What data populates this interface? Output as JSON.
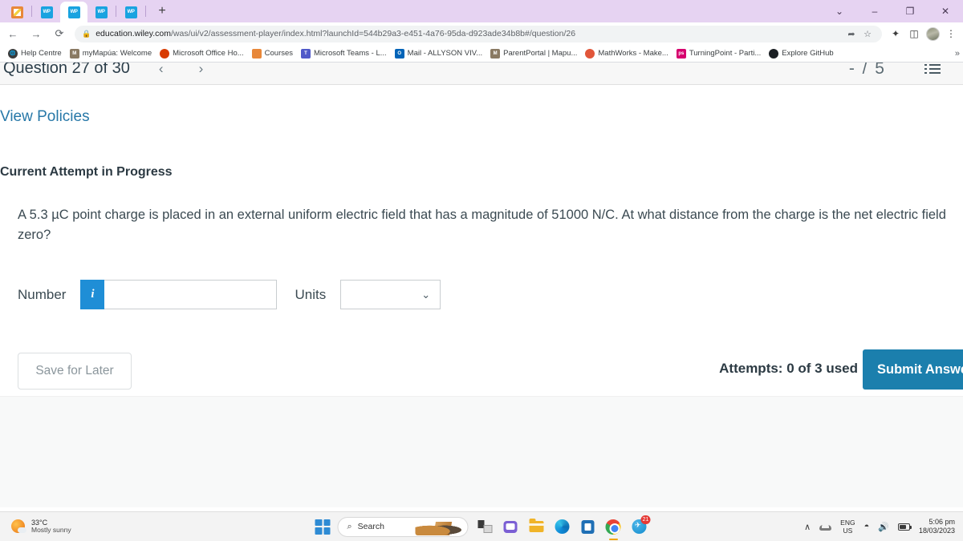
{
  "browser": {
    "tabs": [
      {
        "icon": "canvas-favicon",
        "type": "canvas",
        "active": false
      },
      {
        "icon": "wiley-favicon",
        "type": "wiley",
        "active": false
      },
      {
        "icon": "wiley-favicon",
        "type": "wiley",
        "active": true
      },
      {
        "icon": "wiley-favicon",
        "type": "wiley",
        "active": false
      },
      {
        "icon": "wiley-favicon",
        "type": "wiley",
        "active": false
      }
    ],
    "new_tab_label": "+",
    "window_controls": {
      "tab_search": "⌄",
      "minimize": "–",
      "maximize": "❐",
      "close": "✕"
    },
    "nav": {
      "back": "←",
      "forward": "→",
      "reload": "⟳"
    },
    "omnibox": {
      "lock_icon": "lock-icon",
      "url_domain": "education.wiley.com",
      "url_path": "/was/ui/v2/assessment-player/index.html?launchId=544b29a3-e451-4a76-95da-d923ade34b8b#/question/26",
      "share_icon": "➦",
      "bookmark_star": "☆"
    },
    "toolbar_right": {
      "extensions": "✦",
      "side_panel": "◫",
      "profile": "avatar",
      "menu": "⋮"
    },
    "bookmarks": [
      {
        "label": "Help Centre",
        "icon_text": "",
        "icon_color": "#3b3b3b"
      },
      {
        "label": "myMapúa: Welcome",
        "icon_text": "",
        "icon_color": "#6b5b4a"
      },
      {
        "label": "Microsoft Office Ho...",
        "icon_text": "",
        "icon_color": "#d83b01"
      },
      {
        "label": "Courses",
        "icon_text": "",
        "icon_color": "#e8883a"
      },
      {
        "label": "Microsoft Teams - L...",
        "icon_text": "",
        "icon_color": "#5059c9"
      },
      {
        "label": "Mail - ALLYSON VIV...",
        "icon_text": "",
        "icon_color": "#0364b8"
      },
      {
        "label": "ParentPortal | Mapu...",
        "icon_text": "",
        "icon_color": "#6b5b4a"
      },
      {
        "label": "MathWorks - Make...",
        "icon_text": "",
        "icon_color": "#e1563a"
      },
      {
        "label": "TurningPoint - Parti...",
        "icon_text": "ps",
        "icon_color": "#d6006e"
      },
      {
        "label": "Explore GitHub",
        "icon_text": "",
        "icon_color": "#1b1f23"
      }
    ],
    "bookmarks_overflow": "»"
  },
  "assessment": {
    "question_title": "Question 27 of 30",
    "prev_arrow": "‹",
    "next_arrow": "›",
    "score": "- / 5",
    "menu_icon": "list-menu-icon",
    "view_policies_link": "View Policies",
    "attempt_heading": "Current Attempt in Progress",
    "question_text": "A 5.3 µC point charge is placed in an external uniform electric field that has a magnitude of 51000 N/C. At what distance from the charge is the net electric field zero?",
    "number_label": "Number",
    "info_button": "i",
    "number_value": "",
    "number_placeholder": "",
    "units_label": "Units",
    "units_selected": "",
    "units_caret": "⌄",
    "save_for_later": "Save for Later",
    "attempts_text": "Attempts: 0 of 3 used",
    "submit_label": "Submit Answer"
  },
  "taskbar": {
    "weather": {
      "temperature": "33°C",
      "condition": "Mostly sunny"
    },
    "start_label": "start-button",
    "search_placeholder": "Search",
    "search_icon": "⌕",
    "apps": [
      {
        "name": "widgets",
        "badge": ""
      },
      {
        "name": "teams-chat",
        "badge": ""
      },
      {
        "name": "file-explorer",
        "badge": ""
      },
      {
        "name": "microsoft-edge",
        "badge": ""
      },
      {
        "name": "microsoft-store",
        "badge": ""
      },
      {
        "name": "google-chrome",
        "badge": ""
      },
      {
        "name": "telegram",
        "badge": "21"
      }
    ],
    "tray": {
      "overflow_chevron": "∧",
      "onedrive": "onedrive-icon",
      "ime_line1": "ENG",
      "ime_line2": "US",
      "wifi": "◠",
      "volume": "🔊",
      "battery": "battery-icon",
      "time": "5:06 pm",
      "date": "18/03/2023"
    }
  }
}
